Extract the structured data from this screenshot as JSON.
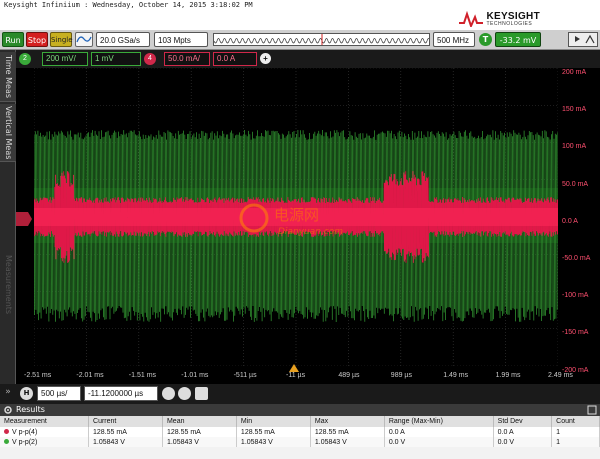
{
  "window": {
    "title": "Keysight Infiniium : Wednesday, October 14, 2015 3:18:02 PM"
  },
  "brand": {
    "name": "KEYSIGHT",
    "tagline": "TECHNOLOGIES"
  },
  "toolbar": {
    "run_label": "Run",
    "stop_label": "Stop",
    "single_label": "Single",
    "sample_rate": "20.0 GSa/s",
    "memory_depth": "103 Mpts",
    "bandwidth": "500 MHz",
    "trigger_label": "T",
    "trigger_level": "-33.2 mV"
  },
  "side_tabs": {
    "time_meas": "Time Meas",
    "vertical_meas": "Vertical Meas",
    "measurements": "Measurements"
  },
  "channels": {
    "ch2": {
      "number": "2",
      "scale": "200 mV/",
      "offset": "1 mV",
      "color": "#3aaa3a"
    },
    "ch4": {
      "number": "4",
      "scale": "50.0 mA/",
      "offset": "0.0 A",
      "color": "#d0284a"
    }
  },
  "y_axis_labels": [
    "200 mA",
    "150 mA",
    "100 mA",
    "50.0 mA",
    "0.0 A",
    "-50.0 mA",
    "-100 mA",
    "-150 mA",
    "-200 mA"
  ],
  "x_axis_labels": [
    "-2.51 ms",
    "-2.01 ms",
    "-1.51 ms",
    "-1.01 ms",
    "-511 µs",
    "-11 µs",
    "489 µs",
    "989 µs",
    "1.49 ms",
    "1.99 ms",
    "2.49 ms"
  ],
  "horizontal": {
    "label": "H",
    "scale": "500 µs/",
    "delay": "-11.1200000 µs"
  },
  "watermark": {
    "cn": "电源网",
    "en": "Dianyuan.com"
  },
  "results": {
    "title": "Results",
    "columns": [
      "Measurement",
      "Current",
      "Mean",
      "Min",
      "Max",
      "Range (Max-Min)",
      "Std Dev",
      "Count"
    ],
    "rows": [
      {
        "color": "#d0284a",
        "cells": [
          "V p-p(4)",
          "128.55 mA",
          "128.55 mA",
          "128.55 mA",
          "128.55 mA",
          "0.0 A",
          "0.0 A",
          "1"
        ]
      },
      {
        "color": "#3aaa3a",
        "cells": [
          "V p-p(2)",
          "1.05843 V",
          "1.05843 V",
          "1.05843 V",
          "1.05843 V",
          "0.0 V",
          "0.0 V",
          "1"
        ]
      }
    ]
  }
}
